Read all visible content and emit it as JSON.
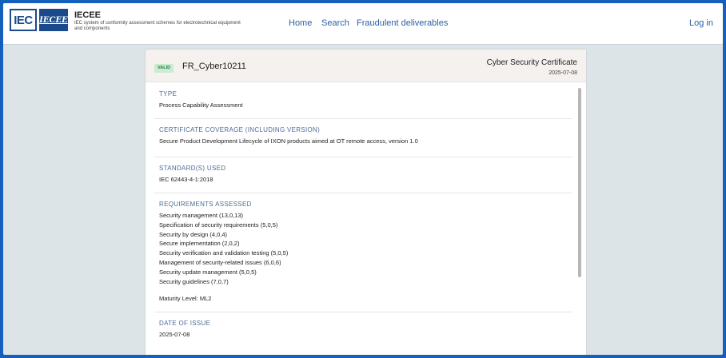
{
  "header": {
    "logo_iec": "IEC",
    "logo_iecee": "IECEE",
    "brand_title": "IECEE",
    "brand_subtitle": "IEC system of conformity assessment schemes for electrotechnical equipment and components",
    "nav": [
      "Home",
      "Search",
      "Fraudulent deliverables"
    ],
    "login": "Log in"
  },
  "certificate": {
    "status_badge": "VALID",
    "id": "FR_Cyber10211",
    "type": "Cyber Security Certificate",
    "date": "2025-07-08",
    "sections": {
      "type": {
        "label": "TYPE",
        "value": "Process Capability Assessment"
      },
      "coverage": {
        "label": "CERTIFICATE COVERAGE (INCLUDING VERSION)",
        "value": "Secure Product Development Lifecycle of IXON products aimed at OT remote access, version 1.0"
      },
      "standards": {
        "label": "STANDARD(S) USED",
        "value": "IEC 62443-4-1:2018"
      },
      "requirements": {
        "label": "REQUIREMENTS ASSESSED",
        "items": [
          "Security management (13,0,13)",
          "Specification of security requirements (5,0,5)",
          "Security by design (4,0,4)",
          "Secure implementation (2,0,2)",
          "Security verification and validation testing (5,0,5)",
          "Management of security-related issues (6,0,6)",
          "Security update management (5,0,5)",
          "Security guidelines (7,0,7)"
        ],
        "maturity": "Maturity Level: ML2"
      },
      "date_of_issue": {
        "label": "DATE OF ISSUE",
        "value": "2025-07-08"
      }
    }
  },
  "colors": {
    "border": "#1560bd",
    "background": "#dde4e7",
    "accent": "#2a5fa3",
    "badge": "#c9ecd2"
  }
}
